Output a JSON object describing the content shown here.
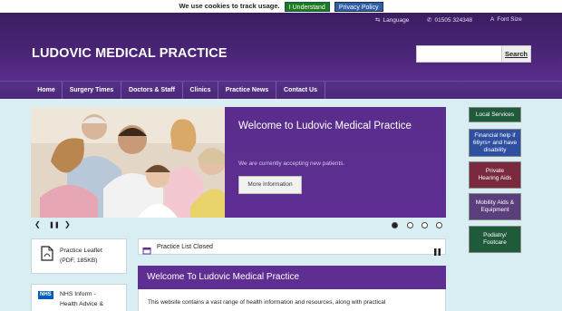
{
  "cookie": {
    "message": "We use cookies to track usage.",
    "understand_label": "I Understand",
    "privacy_label": "Privacy Policy"
  },
  "header": {
    "language_label": "Language",
    "phone": "01505 324348",
    "font_size_label": "Font Size",
    "site_title": "LUDOVIC MEDICAL PRACTICE",
    "search_placeholder": "",
    "search_label": "Search"
  },
  "nav": {
    "items": [
      {
        "label": "Home"
      },
      {
        "label": "Surgery Times"
      },
      {
        "label": "Doctors & Staff"
      },
      {
        "label": "Clinics"
      },
      {
        "label": "Practice News"
      },
      {
        "label": "Contact Us"
      }
    ]
  },
  "hero": {
    "title": "Welcome to Ludovic Medical Practice",
    "subtitle": "We are currently accepting new patients.",
    "button_label": "More Information",
    "controls": {
      "prev": "❮",
      "pause": "❚❚",
      "next": "❯"
    },
    "slide_count": 4,
    "active_slide": 1
  },
  "sidebar": {
    "items": [
      {
        "label": "Local Services",
        "color": "#1f5a3a"
      },
      {
        "label": "Financial help if 66yrs+ and have disability",
        "color": "#2f4fa0"
      },
      {
        "label": "Private Hearing Aids",
        "color": "#7a2a3e"
      },
      {
        "label": "Mobility Aids & Equipment",
        "color": "#5a3f7c"
      },
      {
        "label": "Podiatry/ Footcare",
        "color": "#1f5a3a"
      }
    ]
  },
  "boxes": {
    "leaflet_line1": "Practice Leaflet",
    "leaflet_line2": "(PDF, 185KB)",
    "nhs_badge": "NHS",
    "nhs_line1": "NHS Inform -",
    "nhs_line2": "Health Advice &"
  },
  "notice": {
    "text": "Practice List Closed"
  },
  "welcome": {
    "title": "Welcome To Ludovic Medical Practice",
    "body": "This website contains a vast range of health information and resources, along with practical"
  },
  "colors": {
    "brand_purple": "#5e2e92",
    "page_background": "#d9eef2"
  }
}
